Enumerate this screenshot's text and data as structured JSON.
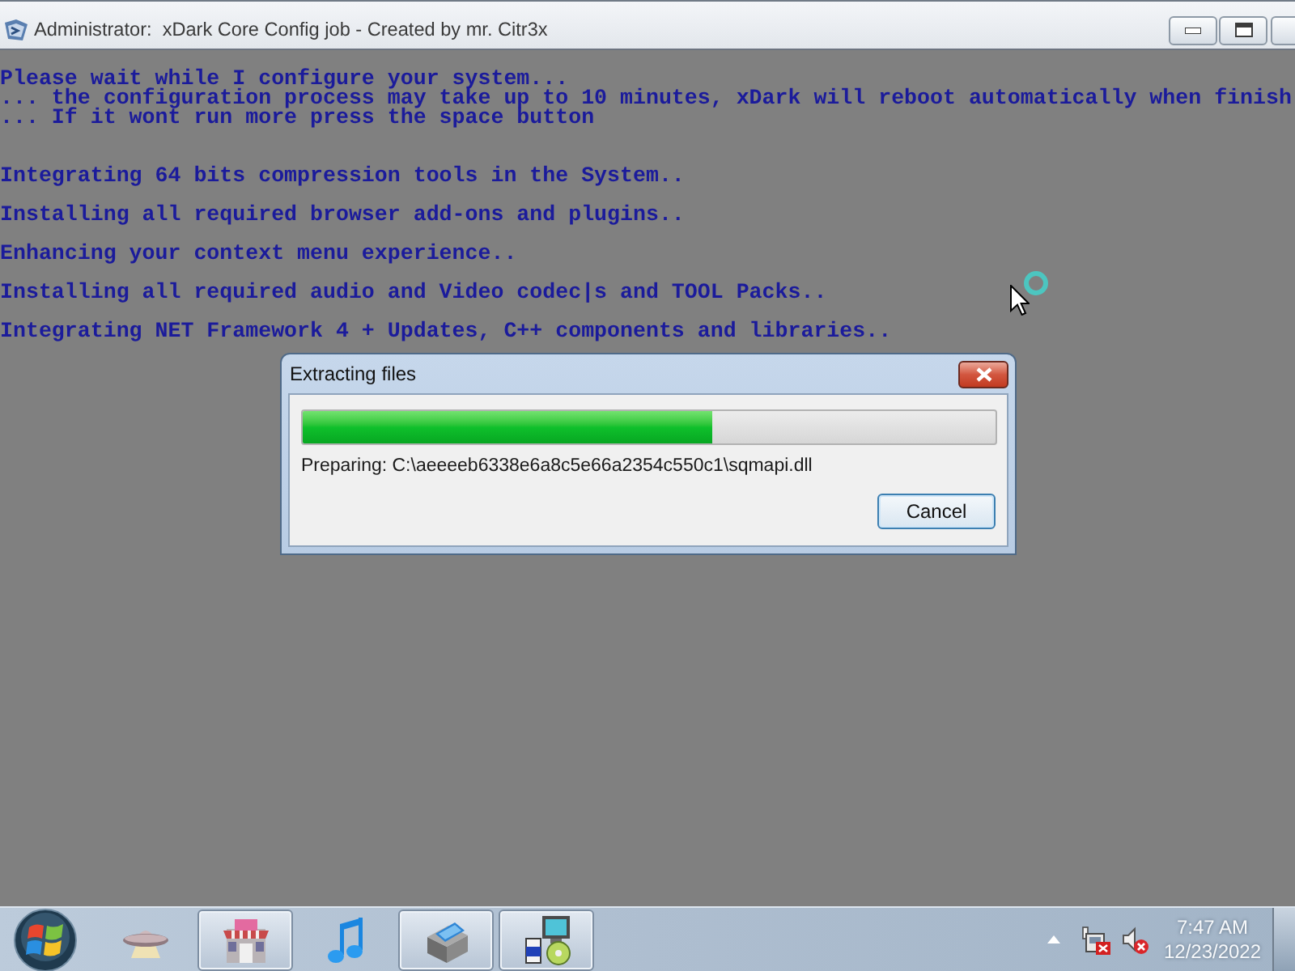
{
  "window": {
    "title": "Administrator:  xDark Core Config job - Created by mr. Citr3x"
  },
  "console": {
    "header": [
      "Please wait while I configure your system...",
      "... the configuration process may take up to 10 minutes, xDark will reboot automatically when finish",
      "... If it wont run more press the space button"
    ],
    "steps": [
      "Integrating 64 bits compression tools in the System..",
      "Installing all required browser add-ons and plugins..",
      "Enhancing your context menu experience..",
      "Installing all required audio and Video codec|s and TOOL Packs..",
      "Integrating NET Framework 4 + Updates, C++ components and libraries.."
    ]
  },
  "dialog": {
    "title": "Extracting files",
    "progress": {
      "level": 0.59
    },
    "status": "Preparing: C:\\aeeeeb6338e6a8c5e66a2354c550c1\\sqmapi.dll",
    "buttons": [
      "Cancel"
    ]
  },
  "taskbar": {
    "items": [
      {
        "running": false
      },
      {
        "running": true
      },
      {
        "running": false
      },
      {
        "running": true
      },
      {
        "running": true
      }
    ],
    "clock": {
      "time": "7:47 AM",
      "date": "12/23/2022"
    }
  }
}
